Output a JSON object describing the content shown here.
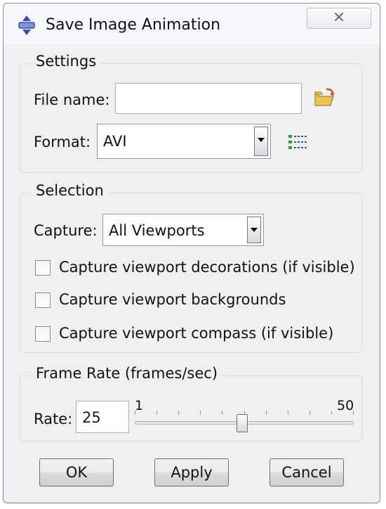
{
  "window": {
    "title": "Save Image Animation",
    "close_symbol": "✕"
  },
  "settings": {
    "group_title": "Settings",
    "file_name_label": "File name:",
    "file_name_value": "",
    "format_label": "Format:",
    "format_value": "AVI",
    "browse_icon": "folder-open-icon",
    "options_icon": "list-options-icon"
  },
  "selection": {
    "group_title": "Selection",
    "capture_label": "Capture:",
    "capture_value": "All Viewports",
    "checkboxes": [
      {
        "label": "Capture viewport decorations (if visible)",
        "checked": false
      },
      {
        "label": "Capture viewport backgrounds",
        "checked": false
      },
      {
        "label": "Capture viewport compass (if visible)",
        "checked": false
      }
    ]
  },
  "frame_rate": {
    "group_title": "Frame Rate (frames/sec)",
    "rate_label": "Rate:",
    "rate_value": "25",
    "slider_min": "1",
    "slider_max": "50",
    "slider_value": 25
  },
  "buttons": {
    "ok": "OK",
    "apply": "Apply",
    "cancel": "Cancel"
  }
}
